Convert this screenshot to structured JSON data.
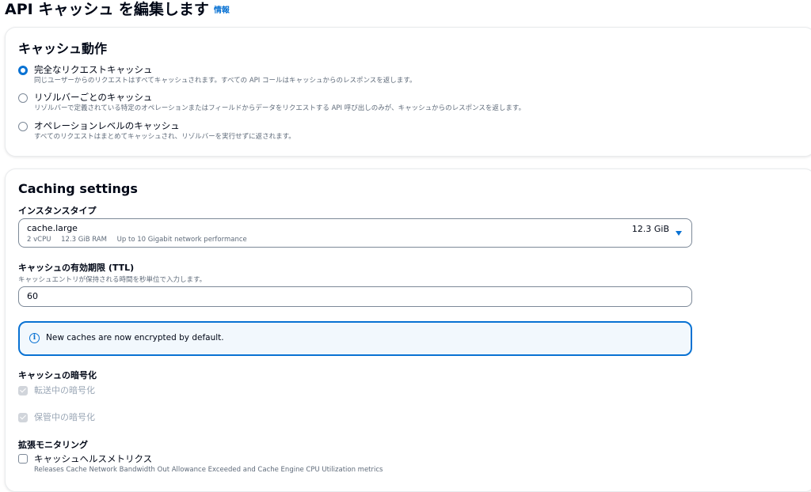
{
  "header": {
    "title": "API キャッシュ を編集します",
    "info_link": "情報"
  },
  "cache_behavior": {
    "title": "キャッシュ動作",
    "options": [
      {
        "label": "完全なリクエストキャッシュ",
        "description": "同じユーザーからのリクエストはすべてキャッシュされます。すべての API コールはキャッシュからのレスポンスを返します。",
        "selected": true
      },
      {
        "label": "リゾルバーごとのキャッシュ",
        "description": "リゾルバーで定義されている特定のオペレーションまたはフィールドからデータをリクエストする API 呼び出しのみが、キャッシュからのレスポンスを返します。",
        "selected": false
      },
      {
        "label": "オペレーションレベルのキャッシュ",
        "description": "すべてのリクエストはまとめてキャッシュされ、リゾルバーを実行せずに返されます。",
        "selected": false
      }
    ]
  },
  "caching_settings": {
    "title": "Caching settings",
    "instance_type": {
      "label": "インスタンスタイプ",
      "selected_name": "cache.large",
      "specs": [
        "2 vCPU",
        "12.3 GiB RAM",
        "Up to 10 Gigabit network performance"
      ],
      "size": "12.3 GiB"
    },
    "ttl": {
      "label": "キャッシュの有効期限 (TTL)",
      "description": "キャッシュエントリが保持される時間を秒単位で入力します。",
      "value": "60"
    },
    "alert": {
      "icon": "info-icon",
      "text": "New caches are now encrypted by default."
    },
    "encryption": {
      "label": "キャッシュの暗号化",
      "in_transit": "転送中の暗号化",
      "at_rest": "保管中の暗号化"
    },
    "monitoring": {
      "label": "拡張モニタリング",
      "checkbox_label": "キャッシュヘルスメトリクス",
      "description": "Releases Cache Network Bandwidth Out Allowance Exceeded and Cache Engine CPU Utilization metrics",
      "checked": false
    }
  },
  "colors": {
    "accent": "#0972d3",
    "text": "#000716",
    "secondary_text": "#5f6b7a",
    "alert_bg": "#f2f8fd"
  }
}
